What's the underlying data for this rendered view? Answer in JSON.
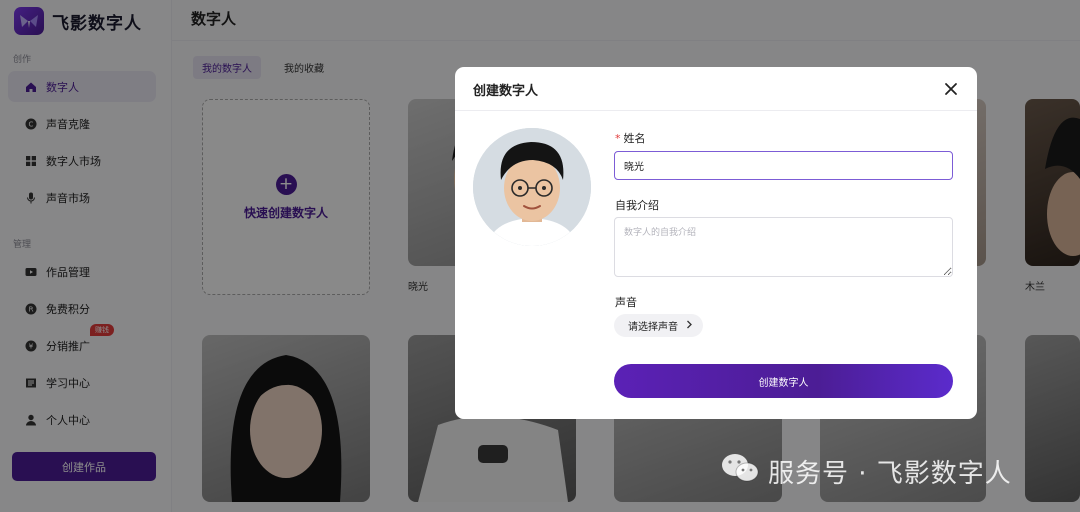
{
  "app": {
    "name": "飞影数字人"
  },
  "sidebar": {
    "sections": [
      {
        "label": "创作"
      },
      {
        "label": "管理"
      }
    ],
    "items": [
      {
        "label": "数字人",
        "icon": "home-icon"
      },
      {
        "label": "声音克隆",
        "icon": "c-circle-icon"
      },
      {
        "label": "数字人市场",
        "icon": "grid-icon"
      },
      {
        "label": "声音市场",
        "icon": "mic-icon"
      },
      {
        "label": "作品管理",
        "icon": "video-icon"
      },
      {
        "label": "免费积分",
        "icon": "points-icon"
      },
      {
        "label": "分销推广",
        "icon": "yen-icon",
        "badge": "赚钱"
      },
      {
        "label": "学习中心",
        "icon": "book-icon"
      },
      {
        "label": "个人中心",
        "icon": "user-icon"
      }
    ],
    "create_button": "创建作品"
  },
  "main": {
    "title": "数字人",
    "tabs": [
      {
        "label": "我的数字人",
        "active": true
      },
      {
        "label": "我的收藏",
        "active": false
      }
    ],
    "quick_create": "快速创建数字人",
    "cards": [
      {
        "name": "晓光"
      },
      {
        "name": "木兰"
      }
    ]
  },
  "modal": {
    "title": "创建数字人",
    "name_label": "姓名",
    "name_required_mark": "*",
    "name_value": "晓光",
    "intro_label": "自我介绍",
    "intro_placeholder": "数字人的自我介绍",
    "voice_label": "声音",
    "voice_button": "请选择声音",
    "submit": "创建数字人"
  },
  "watermark": {
    "text": "服务号 · 飞影数字人"
  },
  "colors": {
    "brand": "#4c1d95",
    "accent": "#7c5cd6",
    "badge": "#e23b3b"
  }
}
